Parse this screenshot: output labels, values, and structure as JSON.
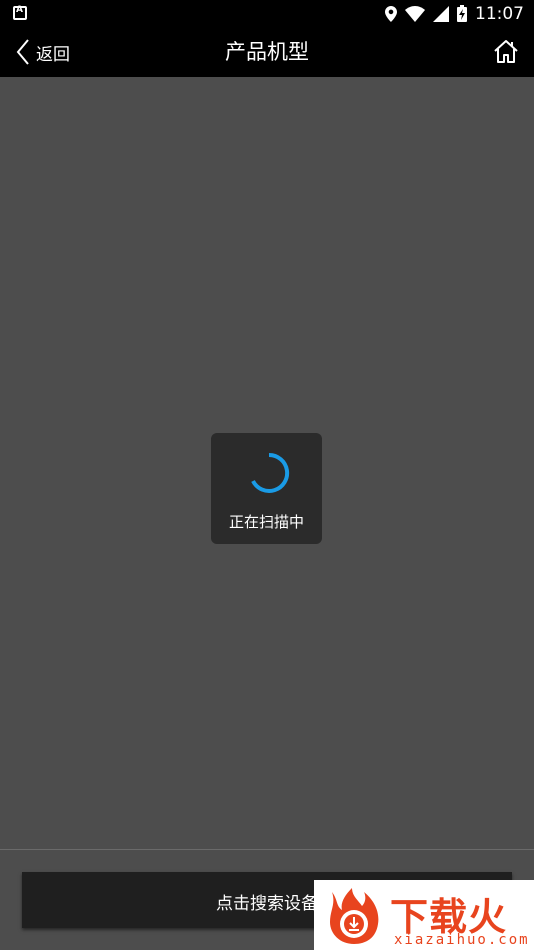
{
  "status_bar": {
    "time": "11:07",
    "icons": [
      "notification-a-icon",
      "location-icon",
      "wifi-icon",
      "signal-icon",
      "battery-icon"
    ]
  },
  "header": {
    "back_label": "返回",
    "title": "产品机型",
    "home_icon": "home-icon"
  },
  "loading_dialog": {
    "message": "正在扫描中",
    "spinner_color": "#1a9be6"
  },
  "bottom": {
    "search_button_label": "点击搜索设备"
  },
  "watermark": {
    "brand_cn": "下载火",
    "brand_en": "xiazaihuo.com",
    "brand_color": "#e8441e"
  }
}
